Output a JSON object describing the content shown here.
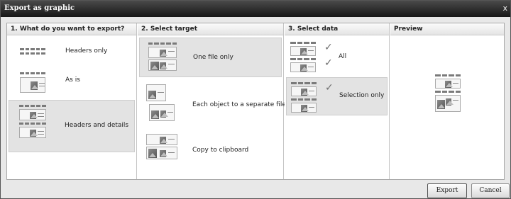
{
  "window": {
    "title": "Export as graphic",
    "close_glyph": "x"
  },
  "columns": [
    {
      "heading": "1. What do you want to export?"
    },
    {
      "heading": "2. Select target"
    },
    {
      "heading": "3. Select data"
    },
    {
      "heading": "Preview"
    }
  ],
  "export_options": [
    {
      "label": "Headers only",
      "icon": "headers-only-icon",
      "selected": false
    },
    {
      "label": "As is",
      "icon": "as-is-icon",
      "selected": false
    },
    {
      "label": "Headers and details",
      "icon": "headers-and-details-icon",
      "selected": true
    }
  ],
  "target_options": [
    {
      "label": "One file only",
      "icon": "one-file-icon",
      "selected": true
    },
    {
      "label": "Each object to a separate file",
      "icon": "separate-files-icon",
      "selected": false
    },
    {
      "label": "Copy to clipboard",
      "icon": "clipboard-icon",
      "selected": false
    }
  ],
  "data_options": [
    {
      "label": "All",
      "icon": "all-data-icon",
      "selected": false
    },
    {
      "label": "Selection only",
      "icon": "selection-only-icon",
      "selected": true
    }
  ],
  "buttons": {
    "export": "Export",
    "cancel": "Cancel"
  },
  "colors": {
    "titlebar": "#1e1e1e",
    "selected": "#e3e3e3",
    "check": "#6e6e6e"
  }
}
